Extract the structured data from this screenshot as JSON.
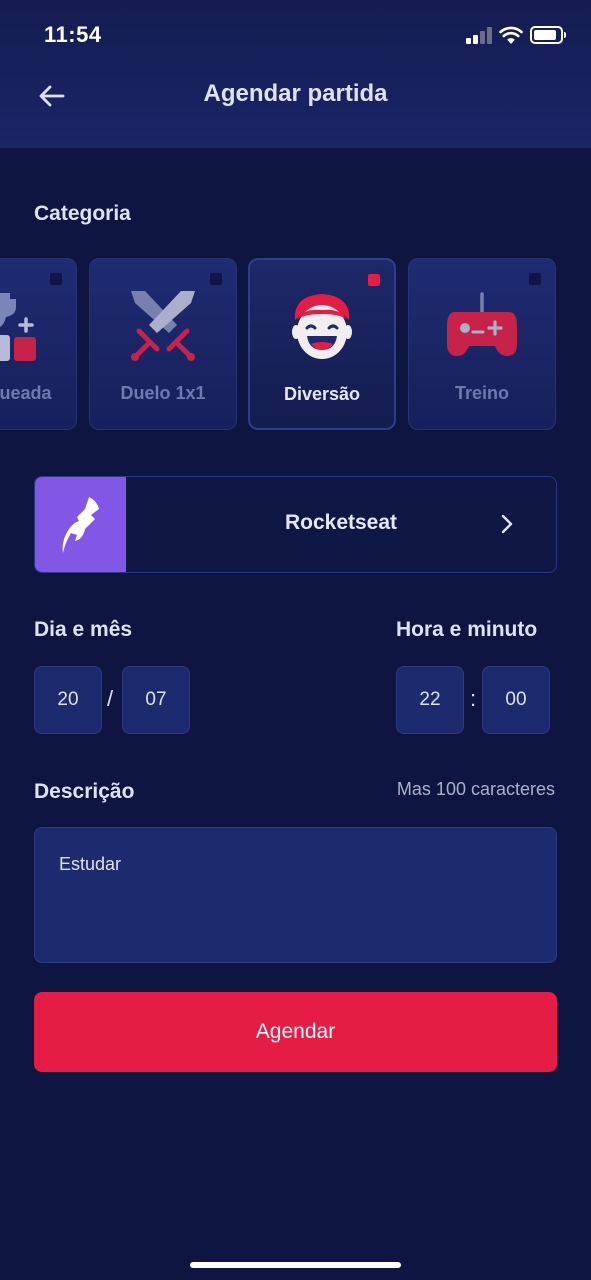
{
  "status_bar": {
    "time": "11:54"
  },
  "header": {
    "title": "Agendar partida"
  },
  "category": {
    "label": "Categoria",
    "items": [
      {
        "label": "Ranqueada",
        "icon": "trophy-icon",
        "selected": false
      },
      {
        "label": "Duelo 1x1",
        "icon": "crossed-swords-icon",
        "selected": false
      },
      {
        "label": "Diversão",
        "icon": "smiling-face-icon",
        "selected": true
      },
      {
        "label": "Treino",
        "icon": "gamepad-icon",
        "selected": false
      }
    ]
  },
  "guild": {
    "name": "Rocketseat",
    "icon": "rocketseat-logo-icon"
  },
  "date": {
    "label": "Dia e mês",
    "day": "20",
    "separator": "/",
    "month": "07"
  },
  "time": {
    "label": "Hora e minuto",
    "hour": "22",
    "separator": ":",
    "minute": "00"
  },
  "description": {
    "label": "Descrição",
    "limit_text": "Mas 100 caracteres",
    "value": "Estudar"
  },
  "submit": {
    "label": "Agendar"
  },
  "colors": {
    "background": "#0e1540",
    "accent": "#e51c44",
    "guild_avatar": "#8257e5"
  }
}
